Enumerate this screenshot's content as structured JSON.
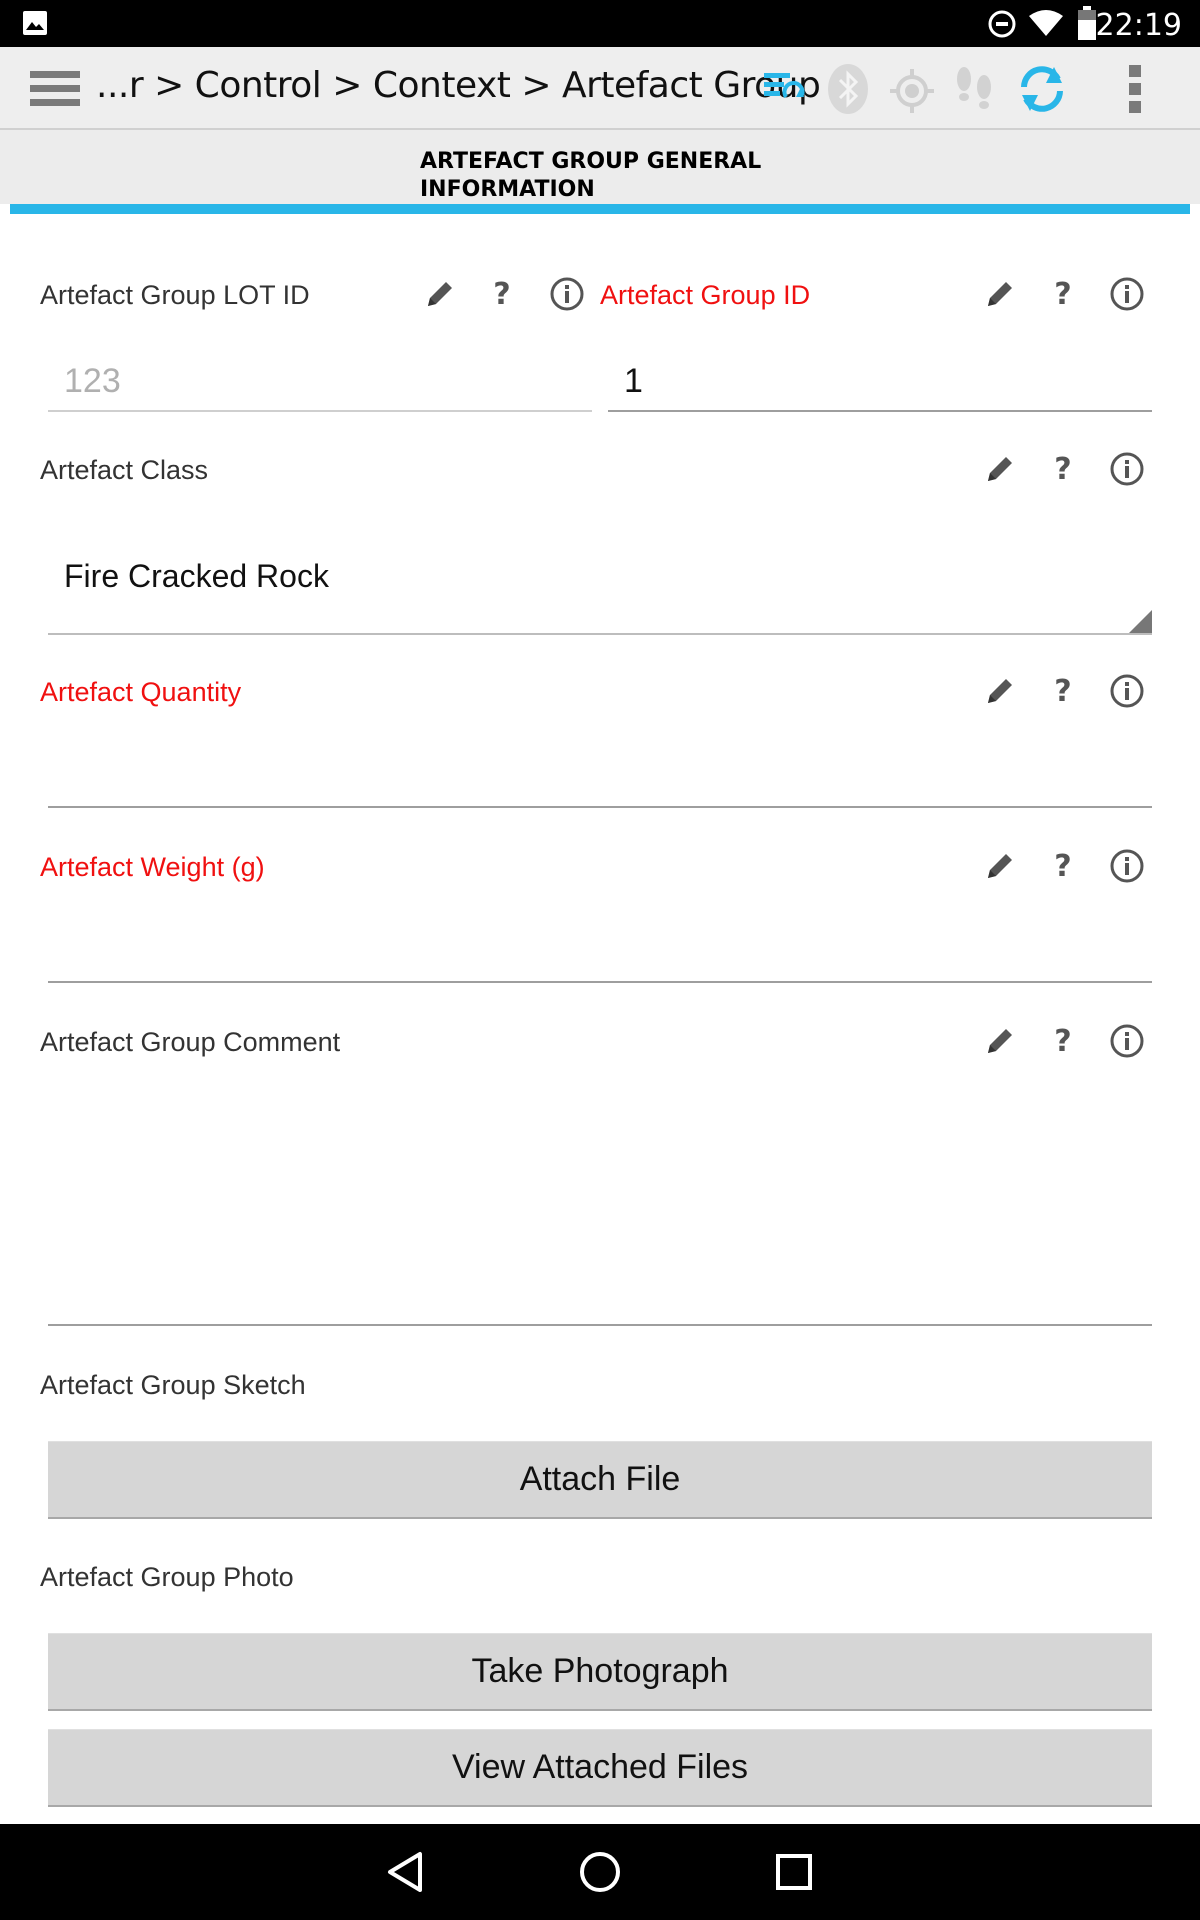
{
  "status_bar": {
    "time": "22:19"
  },
  "action_bar": {
    "breadcrumb": "...r > Control > Context > Artefact Group",
    "accent": "#29b6e8"
  },
  "section": {
    "title": "ARTEFACT GROUP GENERAL INFORMATION"
  },
  "fields": {
    "lot_id": {
      "label": "Artefact Group LOT ID",
      "placeholder": "123",
      "value": ""
    },
    "group_id": {
      "label": "Artefact Group ID",
      "value": "1"
    },
    "artefact_class": {
      "label": "Artefact Class",
      "value": "Fire Cracked Rock"
    },
    "quantity": {
      "label": "Artefact Quantity",
      "value": ""
    },
    "weight": {
      "label": "Artefact Weight (g)",
      "value": ""
    },
    "comment": {
      "label": "Artefact Group Comment",
      "value": ""
    },
    "sketch": {
      "label": "Artefact Group Sketch",
      "button": "Attach File"
    },
    "photo": {
      "label": "Artefact Group Photo",
      "take_button": "Take Photograph",
      "view_button": "View Attached Files"
    }
  },
  "icons": {
    "question": "?",
    "required_color": "#f01010"
  }
}
